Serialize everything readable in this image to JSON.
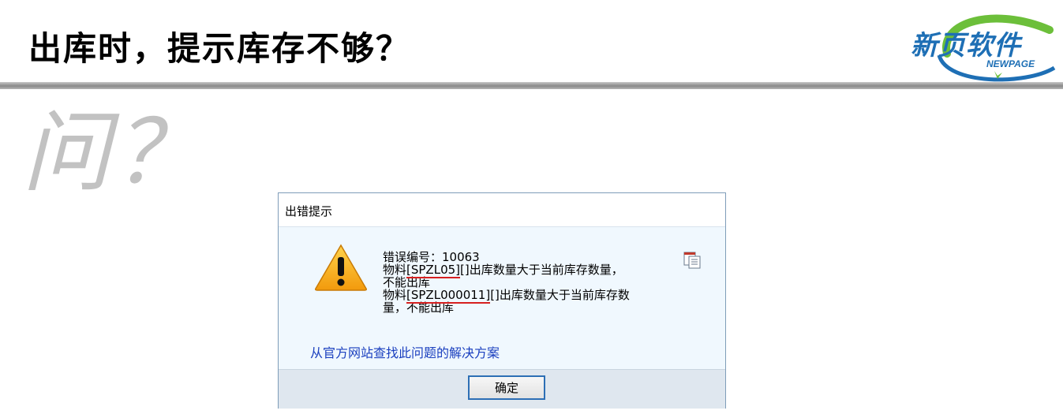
{
  "slide": {
    "title": "出库时，提示库存不够？",
    "ask_label": "问？"
  },
  "logo": {
    "name": "新页软件",
    "sub": "NEWPAGE",
    "colors": {
      "blue": "#1e6fb5",
      "green": "#6cbf3a"
    }
  },
  "dialog": {
    "title": "出错提示",
    "error_number_line": "错误编号：10063",
    "line2_prefix": "物料",
    "line2_code": "[SPZL05]",
    "line2_suffix": "[]出库数量大于当前库存数量，",
    "line3": "不能出库",
    "line4_prefix": "物料",
    "line4_code": "[SPZL000011]",
    "line4_suffix": "[]出库数量大于当前库存数",
    "line5": "量，不能出库",
    "help_link": "从官方网站查找此问题的解决方案",
    "ok_label": "确定",
    "icons": {
      "warning": "warning-triangle-icon",
      "copy": "copy-icon"
    }
  }
}
